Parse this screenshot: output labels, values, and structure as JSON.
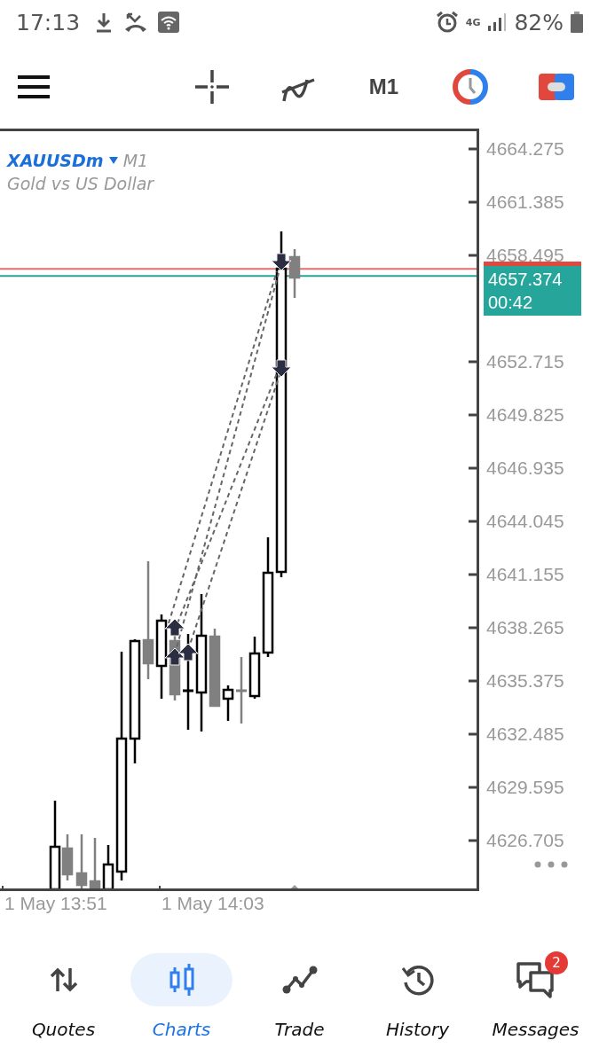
{
  "status_bar": {
    "time": "17:13",
    "network": "4G",
    "battery": "82%"
  },
  "toolbar": {
    "timeframe": "M1"
  },
  "chart": {
    "symbol": "XAUUSDm",
    "timeframe": "M1",
    "description": "Gold vs US Dollar",
    "price_ticks": [
      "4664.275",
      "4661.385",
      "4658.495",
      "4652.715",
      "4649.825",
      "4646.935",
      "4644.045",
      "4641.155",
      "4638.265",
      "4635.375",
      "4632.485",
      "4629.595",
      "4626.705"
    ],
    "current_price": "4657.374",
    "countdown": "00:42",
    "time_labels": [
      "1 May 13:51",
      "1 May 14:03"
    ]
  },
  "nav": [
    {
      "label": "Quotes",
      "selected": false
    },
    {
      "label": "Charts",
      "selected": true
    },
    {
      "label": "Trade",
      "selected": false
    },
    {
      "label": "History",
      "selected": false
    },
    {
      "label": "Messages",
      "selected": false,
      "badge": "2"
    }
  ]
}
